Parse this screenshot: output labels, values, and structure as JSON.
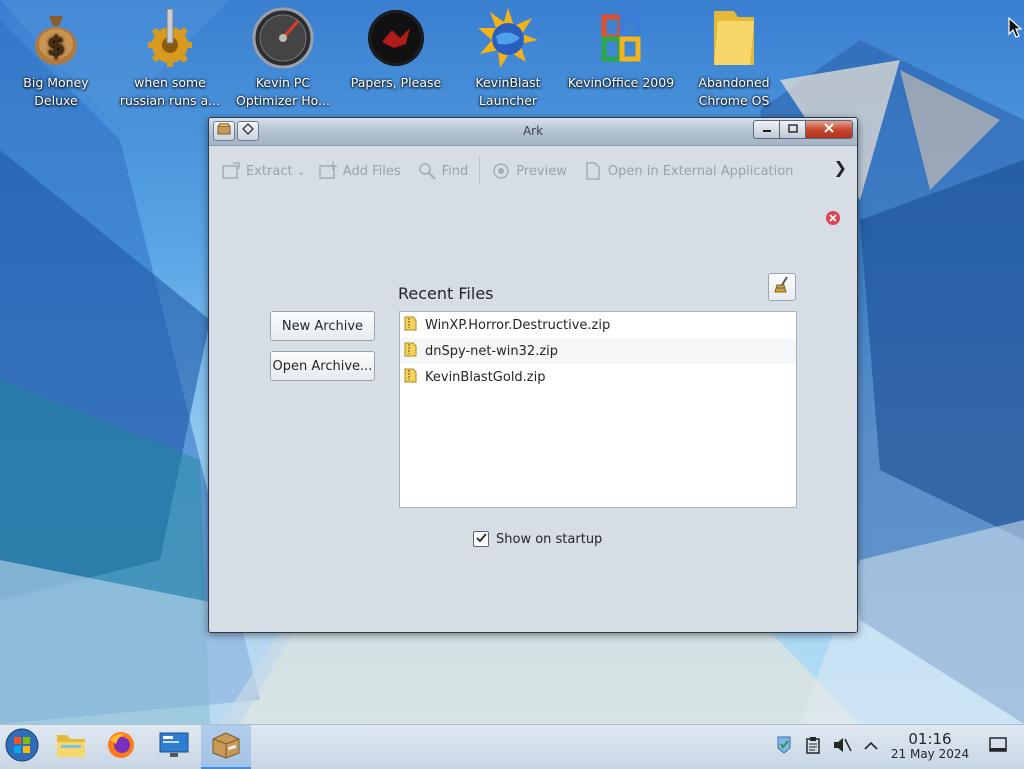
{
  "desktop": {
    "icons": [
      {
        "label": "Big Money Deluxe",
        "icon": "money-bag-icon"
      },
      {
        "label": "when some russian runs a...",
        "icon": "gear-icon"
      },
      {
        "label": "Kevin PC Optimizer Ho...",
        "icon": "speedometer-icon"
      },
      {
        "label": "Papers, Please",
        "icon": "red-emblem-icon"
      },
      {
        "label": "KevinBlast Launcher",
        "icon": "globe-burst-icon"
      },
      {
        "label": "KevinOffice 2009",
        "icon": "office-logo-icon"
      },
      {
        "label": "Abandoned Chrome OS",
        "icon": "folder-icon"
      }
    ]
  },
  "window": {
    "title": "Ark",
    "toolbar": {
      "extract": "Extract",
      "add_files": "Add Files",
      "find": "Find",
      "preview": "Preview",
      "open_external": "Open in External Application"
    },
    "new_archive": "New Archive",
    "open_archive": "Open Archive...",
    "recent_title": "Recent Files",
    "recent_files": [
      "WinXP.Horror.Destructive.zip",
      "dnSpy-net-win32.zip",
      "KevinBlastGold.zip"
    ],
    "show_on_startup": "Show on startup",
    "show_on_startup_checked": true
  },
  "taskbar": {
    "apps": [
      "start-orb-icon",
      "file-manager-icon",
      "firefox-icon",
      "system-settings-icon",
      "ark-icon"
    ],
    "active_app": "ark-icon",
    "tray": [
      "network-icon",
      "clipboard-icon",
      "volume-muted-icon",
      "tray-expand-icon"
    ],
    "time": "01:16",
    "date": "21 May 2024"
  },
  "colors": {
    "accent": "#3d8ee8",
    "close_button": "#c4442a"
  }
}
